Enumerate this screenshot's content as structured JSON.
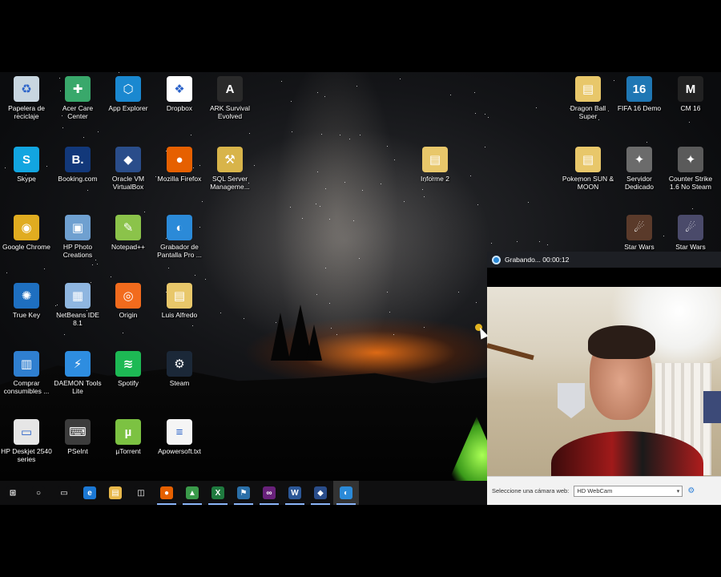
{
  "desktop": {
    "icons": [
      {
        "label": "Papelera de reciclaje",
        "icon": "recycle-bin-icon",
        "color": "#c8d6e0",
        "glyph": "♻"
      },
      {
        "label": "Acer Care Center",
        "icon": "acer-care-icon",
        "color": "#39a86b",
        "glyph": "✚"
      },
      {
        "label": "App Explorer",
        "icon": "app-explorer-icon",
        "color": "#1a88d0",
        "glyph": "⬡"
      },
      {
        "label": "Dropbox",
        "icon": "dropbox-icon",
        "color": "#ffffff",
        "glyph": "❖"
      },
      {
        "label": "ARK Survival Evolved",
        "icon": "ark-icon",
        "color": "#2a2a2a",
        "glyph": "A"
      },
      {
        "label": "Skype",
        "icon": "skype-icon",
        "color": "#12a5e0",
        "glyph": "S"
      },
      {
        "label": "Booking.com",
        "icon": "booking-icon",
        "color": "#12387a",
        "glyph": "B."
      },
      {
        "label": "Oracle VM VirtualBox",
        "icon": "virtualbox-icon",
        "color": "#2a4d8a",
        "glyph": "◆"
      },
      {
        "label": "Mozilla Firefox",
        "icon": "firefox-icon",
        "color": "#e66000",
        "glyph": "●"
      },
      {
        "label": "SQL Server Manageme...",
        "icon": "sql-server-icon",
        "color": "#d8b44a",
        "glyph": "⚒"
      },
      {
        "label": "Google Chrome",
        "icon": "chrome-icon",
        "color": "#e0ac20",
        "glyph": "◉"
      },
      {
        "label": "HP Photo Creations",
        "icon": "hp-photo-icon",
        "color": "#6fa0d0",
        "glyph": "▣"
      },
      {
        "label": "Notepad++",
        "icon": "notepadpp-icon",
        "color": "#8bc34a",
        "glyph": "✎"
      },
      {
        "label": "Grabador de Pantalla Pro ...",
        "icon": "screen-recorder-icon",
        "color": "#2b8ad8",
        "glyph": "◐"
      },
      {
        "label": "True Key",
        "icon": "true-key-icon",
        "color": "#1e6fc0",
        "glyph": "✺"
      },
      {
        "label": "NetBeans IDE 8.1",
        "icon": "netbeans-icon",
        "color": "#8fb6e0",
        "glyph": "▦"
      },
      {
        "label": "Origin",
        "icon": "origin-icon",
        "color": "#f26b1d",
        "glyph": "◎"
      },
      {
        "label": "Luis Alfredo",
        "icon": "folder-icon",
        "color": "#e8c76a",
        "glyph": "▤"
      },
      {
        "label": "Comprar consumibles ...",
        "icon": "printer-supplies-icon",
        "color": "#2f7fd0",
        "glyph": "▥"
      },
      {
        "label": "DAEMON Tools Lite",
        "icon": "daemon-tools-icon",
        "color": "#2e8de0",
        "glyph": "⚡"
      },
      {
        "label": "Spotify",
        "icon": "spotify-icon",
        "color": "#1db954",
        "glyph": "≋"
      },
      {
        "label": "Steam",
        "icon": "steam-icon",
        "color": "#1b2838",
        "glyph": "⚙"
      },
      {
        "label": "HP Deskjet 2540 series",
        "icon": "hp-printer-icon",
        "color": "#e6e6e6",
        "glyph": "▭"
      },
      {
        "label": "PSeInt",
        "icon": "pseint-icon",
        "color": "#3c3c3c",
        "glyph": "⌨"
      },
      {
        "label": "µTorrent",
        "icon": "utorrent-icon",
        "color": "#7cc242",
        "glyph": "µ"
      },
      {
        "label": "Apowersoft.txt",
        "icon": "text-file-icon",
        "color": "#f5f5f5",
        "glyph": "≡"
      },
      {
        "label": "Informe 2",
        "icon": "document-folder-icon",
        "color": "#e8c76a",
        "glyph": "▤"
      },
      {
        "label": "Dragon Ball Super",
        "icon": "dragon-ball-folder-icon",
        "color": "#e8c76a",
        "glyph": "▤"
      },
      {
        "label": "FIFA 16 Demo",
        "icon": "fifa-icon",
        "color": "#1f77b4",
        "glyph": "16"
      },
      {
        "label": "CM 16",
        "icon": "cm16-icon",
        "color": "#222222",
        "glyph": "M"
      },
      {
        "label": "Pokemon SUN & MOON",
        "icon": "pokemon-folder-icon",
        "color": "#e8c76a",
        "glyph": "▤"
      },
      {
        "label": "Servidor Dedicado",
        "icon": "cs-server-icon",
        "color": "#6b6b6b",
        "glyph": "✦"
      },
      {
        "label": "Counter Strike 1.6 No Steam",
        "icon": "counter-strike-icon",
        "color": "#5a5a5a",
        "glyph": "✦"
      },
      {
        "label": "Star Wars Empire",
        "icon": "star-wars-icon",
        "color": "#5a3a2a",
        "glyph": "☄"
      },
      {
        "label": "Star Wars Empire",
        "icon": "star-wars-icon",
        "color": "#4a4a6a",
        "glyph": "☄"
      }
    ]
  },
  "taskbar": {
    "items": [
      {
        "name": "start-button",
        "icon": "windows-start-icon",
        "glyph": "⊞",
        "color": "#0f0f10"
      },
      {
        "name": "search-button",
        "icon": "search-circle-icon",
        "glyph": "○",
        "color": "#0f0f10"
      },
      {
        "name": "task-view-button",
        "icon": "task-view-icon",
        "glyph": "▭",
        "color": "#0f0f10"
      },
      {
        "name": "edge-button",
        "icon": "edge-icon",
        "glyph": "e",
        "color": "#1b78d4"
      },
      {
        "name": "file-explorer-button",
        "icon": "folder-icon",
        "glyph": "▤",
        "color": "#e8b84a"
      },
      {
        "name": "store-button",
        "icon": "store-icon",
        "glyph": "◫",
        "color": "#0f0f10"
      },
      {
        "name": "firefox-button",
        "icon": "firefox-icon",
        "glyph": "●",
        "color": "#e66000"
      },
      {
        "name": "ark-button",
        "icon": "ark-taskbar-icon",
        "glyph": "▲",
        "color": "#3a9a4a"
      },
      {
        "name": "excel-button",
        "icon": "excel-icon",
        "glyph": "X",
        "color": "#1f7a3f"
      },
      {
        "name": "app-button",
        "icon": "app-icon",
        "glyph": "⚑",
        "color": "#2a6fa8"
      },
      {
        "name": "visual-studio-button",
        "icon": "visual-studio-icon",
        "glyph": "∞",
        "color": "#68217a"
      },
      {
        "name": "word-button",
        "icon": "word-icon",
        "glyph": "W",
        "color": "#2b5797"
      },
      {
        "name": "virtualbox-button",
        "icon": "virtualbox-icon",
        "glyph": "◆",
        "color": "#2a4d8a"
      },
      {
        "name": "screen-recorder-button",
        "icon": "screen-recorder-icon",
        "glyph": "◐",
        "color": "#2b8ad8"
      }
    ]
  },
  "recorder": {
    "title": "Grabando... 00:00:12",
    "camera_label": "Seleccione una cámara web:",
    "camera_value": "HD WebCam"
  }
}
